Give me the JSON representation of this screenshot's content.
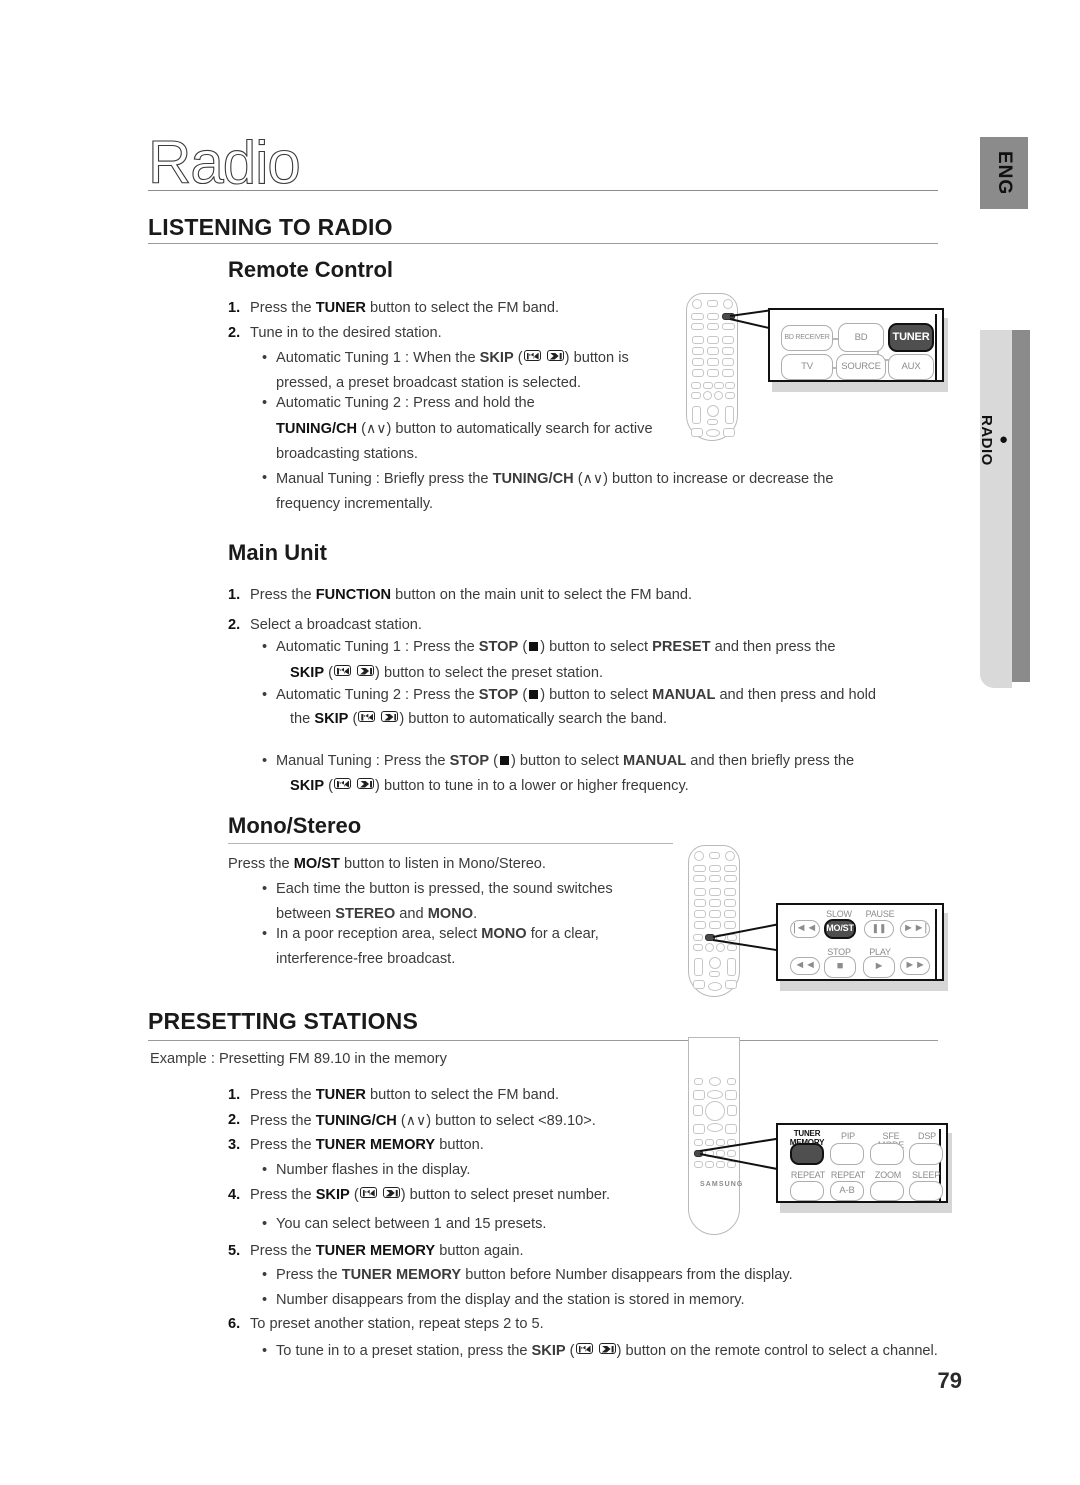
{
  "sidebar": {
    "language_tab": "ENG",
    "section_tab": "RADIO",
    "bullet": "●"
  },
  "chapter": {
    "title": "Radio"
  },
  "page_number": "79",
  "sections": [
    {
      "id": "listening-to-radio",
      "heading": "LISTENING TO RADIO",
      "subsections": [
        {
          "id": "remote-control",
          "heading": "Remote Control",
          "steps": [
            {
              "num": "1.",
              "text_parts": [
                "Press the ",
                "TUNER",
                " button to select the FM band."
              ]
            },
            {
              "num": "2.",
              "text_parts": [
                "Tune in to the desired station."
              ]
            }
          ],
          "bullets": [
            "Automatic Tuning 1 : When the SKIP (  ) button is pressed, a preset broadcast station is selected.",
            "Automatic Tuning 2 : Press and hold the TUNING/CH (∧∨) button to automatically search for active broadcasting stations.",
            "Manual Tuning : Briefly press the TUNING/CH (∧∨) button to increase or decrease the frequency incrementally."
          ]
        },
        {
          "id": "main-unit",
          "heading": "Main Unit",
          "steps": [
            {
              "num": "1.",
              "text_parts": [
                "Press the ",
                "FUNCTION",
                " button on the main unit to select the FM band."
              ]
            },
            {
              "num": "2.",
              "text_parts": [
                "Select a broadcast station."
              ]
            }
          ],
          "bullets": [
            "Automatic Tuning 1 : Press the STOP ( ■ ) button to select PRESET and then press the SKIP (  ) button to select the preset station.",
            "Automatic Tuning 2 : Press the STOP ( ■ ) button to select MANUAL and then press and hold the SKIP (  ) button to automatically search the band.",
            "Manual Tuning : Press the STOP ( ■ ) button to select MANUAL and then briefly press the SKIP (  ) button to tune in to a lower or higher frequency."
          ]
        },
        {
          "id": "mono-stereo",
          "heading": "Mono/Stereo",
          "lead": "Press the MO/ST button to listen in Mono/Stereo.",
          "bullets": [
            "Each time the button is pressed, the sound switches between  STEREO and MONO.",
            "In a poor reception area, select MONO for a clear, interference-free broadcast."
          ]
        }
      ]
    },
    {
      "id": "presetting-stations",
      "heading": "PRESETTING STATIONS",
      "example": "Example : Presetting FM 89.10 in the memory",
      "steps": [
        {
          "num": "1.",
          "text": "Press the TUNER button to select the FM band."
        },
        {
          "num": "2.",
          "text": "Press the TUNING/CH (∧∨)  button to select <89.10>."
        },
        {
          "num": "3.",
          "text": "Press the TUNER MEMORY button."
        },
        {
          "num": "4.",
          "text": "Press the SKIP (  ) button to select preset number."
        },
        {
          "num": "5.",
          "text": "Press the TUNER  MEMORY button again."
        },
        {
          "num": "6.",
          "text": "To preset another station, repeat steps 2 to 5."
        }
      ],
      "sub_bullets": [
        "Number flashes in the display.",
        "You can select between 1 and 15 presets.",
        "Press the TUNER MEMORY button before Number disappears from the display.",
        "Number disappears from the display and the station is stored in memory.",
        "To tune in to a preset station, press the SKIP (  ) button on the remote control to select a channel."
      ]
    }
  ],
  "text_lines": {
    "t1_pre": "Press the ",
    "t1_b": "TUNER",
    "t1_post": " button to select the FM band.",
    "t2": "Tune in to the desired station.",
    "b1_a": "Automatic Tuning 1 : When the ",
    "b1_b": "SKIP",
    "b1_c": " (",
    "b1_d": ") button is",
    "b1_l2": "pressed, a preset broadcast station is selected.",
    "b2_a": "Automatic Tuning 2 : Press and hold the",
    "b2_b": "TUNING/CH",
    "b2_c": " (",
    "b2_d": ") button to automatically search for active",
    "b2_l3": "broadcasting stations.",
    "b3_a": "Manual Tuning : Briefly press the ",
    "b3_b": "TUNING/CH",
    "b3_c": " (",
    "b3_d": ") button to increase or decrease the",
    "b3_l2": "frequency incrementally.",
    "m1_pre": "Press the ",
    "m1_b": "FUNCTION",
    "m1_post": " button on the main unit to select the FM band.",
    "m2": "Select a broadcast station.",
    "mb1_a": "Automatic Tuning 1 : Press the ",
    "mb1_stop": "STOP",
    "mb1_b": " (",
    "mb1_c": ") button to select ",
    "mb1_preset": "PRESET",
    "mb1_d": " and then press the",
    "mb1_l2a": "SKIP",
    "mb1_l2b": " (",
    "mb1_l2c": ") button to select the preset station.",
    "mb2_a": "Automatic Tuning 2 : Press the  ",
    "mb2_stop": "STOP",
    "mb2_b": " (",
    "mb2_c": ") button to select ",
    "mb2_manual": "MANUAL",
    "mb2_d": " and then press and hold",
    "mb2_l2a": "the ",
    "mb2_l2skip": "SKIP",
    "mb2_l2b": " (",
    "mb2_l2c": ") button to automatically search the band.",
    "mb3_a": "Manual Tuning : Press the ",
    "mb3_stop": "STOP",
    "mb3_b": " (",
    "mb3_c": ") button to select ",
    "mb3_manual": "MANUAL",
    "mb3_d": " and then briefly press the",
    "mb3_l2a": "SKIP",
    "mb3_l2b": " (",
    "mb3_l2c": ") button to tune in to a lower or higher frequency.",
    "ms_lead_a": "Press the ",
    "ms_lead_b": "MO/ST",
    "ms_lead_c": " button to listen in Mono/Stereo.",
    "ms_b1_l1": "Each time the button is pressed, the sound switches",
    "ms_b1_l2a": "between  ",
    "ms_b1_l2b": "STEREO",
    "ms_b1_l2c": " and ",
    "ms_b1_l2d": "MONO",
    "ms_b1_l2e": ".",
    "ms_b2_l1a": "In a poor reception area, select ",
    "ms_b2_l1b": "MONO",
    "ms_b2_l1c": " for a clear,",
    "ms_b2_l2": "interference-free broadcast.",
    "ps_example": "Example : Presetting FM 89.10 in the memory",
    "ps1_a": "Press the ",
    "ps1_b": "TUNER",
    "ps1_c": " button to select the FM band.",
    "ps2_a": "Press the ",
    "ps2_b": "TUNING/CH",
    "ps2_c": " (",
    "ps2_d": ")  button to select <89.10>.",
    "ps3_a": "Press the ",
    "ps3_b": "TUNER MEMORY",
    "ps3_c": " button.",
    "ps3_bul": "Number flashes in the display.",
    "ps4_a": "Press the ",
    "ps4_b": "SKIP",
    "ps4_c": " (",
    "ps4_d": ") button to select preset number.",
    "ps4_bul": "You can select between 1 and 15 presets.",
    "ps5_a": "Press the ",
    "ps5_b": "TUNER  MEMORY",
    "ps5_c": " button again.",
    "ps5_bul1a": "Press the ",
    "ps5_bul1b": "TUNER MEMORY",
    "ps5_bul1c": " button before Number disappears from the display.",
    "ps5_bul2": "Number disappears from the display and the station is stored in memory.",
    "ps6": "To preset another station, repeat steps 2 to 5.",
    "ps6_bula": "To tune in to a preset station, press the ",
    "ps6_bulb": "SKIP",
    "ps6_bulc": " (",
    "ps6_buld": ") button on the remote control to select a channel.",
    "num1": "1.",
    "num2": "2.",
    "num3": "3.",
    "num4": "4.",
    "num5": "5.",
    "num6": "6."
  },
  "illustrations": {
    "remote_tuner_callout": {
      "name": "source-buttons-callout",
      "buttons": [
        {
          "label": "BD RECEIVER",
          "selected": false
        },
        {
          "label": "BD",
          "selected": false
        },
        {
          "label": "TUNER",
          "selected": true
        },
        {
          "label": "TV",
          "selected": false
        },
        {
          "label": "SOURCE",
          "selected": false
        },
        {
          "label": "AUX",
          "selected": false
        }
      ]
    },
    "remote_most_callout": {
      "name": "transport-buttons-callout",
      "top_labels": [
        "SLOW",
        "PAUSE"
      ],
      "bottom_labels": [
        "STOP",
        "PLAY"
      ],
      "buttons": [
        {
          "label": "|◄◄",
          "selected": false
        },
        {
          "label": "MO/ST",
          "selected": true
        },
        {
          "label": "❚❚",
          "selected": false
        },
        {
          "label": "►►|",
          "selected": false
        },
        {
          "label": "◄◄",
          "selected": false
        },
        {
          "label": "■",
          "selected": false
        },
        {
          "label": "►",
          "selected": false
        },
        {
          "label": "►►",
          "selected": false
        }
      ]
    },
    "remote_memory_callout": {
      "name": "tuner-memory-callout",
      "top_labels": [
        "TUNER MEMORY",
        "PIP",
        "SFE MODE",
        "DSP"
      ],
      "bottom_labels": [
        "REPEAT",
        "REPEAT",
        "ZOOM",
        "SLEEP"
      ],
      "bottom_button_label": "A-B",
      "selected_index": 0
    },
    "brand": "SAMSUNG"
  },
  "colors": {
    "rule": "#9a9a9a",
    "sidebar_dark": "#8b8b8b",
    "sidebar_light": "#d9d9d9",
    "selected_button": "#4f4f4f",
    "text": "#3b3b3b"
  }
}
